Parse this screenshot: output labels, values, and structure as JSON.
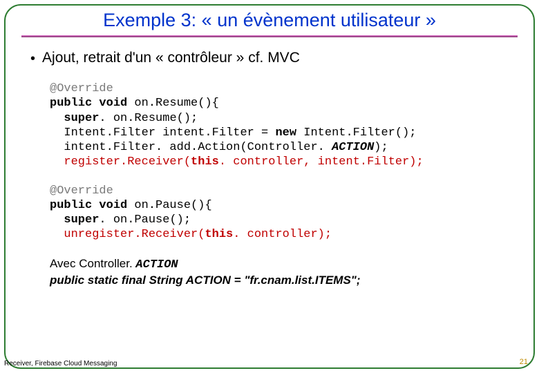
{
  "title": "Exemple 3: « un évènement utilisateur »",
  "bullet": "Ajout, retrait d'un « contrôleur » cf. MVC",
  "code1": {
    "l1": "@Override",
    "l2a": "public void ",
    "l2b": "on.Resume(){",
    "l3a": "  super",
    "l3b": ". on.Resume();",
    "l4a": "  Intent.Filter intent.Filter = ",
    "l4b": "new ",
    "l4c": "Intent.Filter();",
    "l5a": "  intent.Filter. add.Action(Controller. ",
    "l5b": "ACTION",
    "l5c": ");",
    "l6a": "  register.Receiver(",
    "l6b": "this",
    "l6c": ". controller, intent.Filter);"
  },
  "code2": {
    "l1": "@Override",
    "l2a": "public void ",
    "l2b": "on.Pause(){",
    "l3a": "  super",
    "l3b": ". on.Pause();",
    "l4a": "  unregister.Receiver(",
    "l4b": "this",
    "l4c": ". controller);"
  },
  "note": {
    "line1a": "Avec Controller. ",
    "line1b": "ACTION",
    "line2": "public static final String ACTION = \"fr.cnam.list.ITEMS\";"
  },
  "footer": "Receiver, Firebase Cloud Messaging",
  "page": "21"
}
